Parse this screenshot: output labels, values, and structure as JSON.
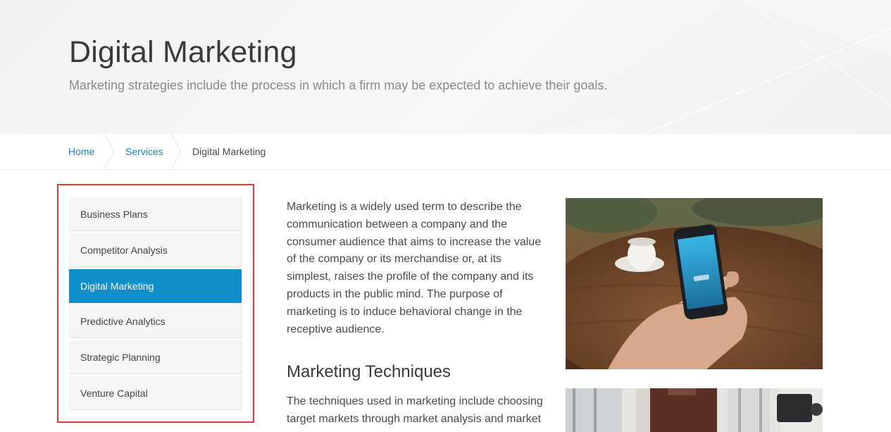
{
  "hero": {
    "title": "Digital Marketing",
    "subtitle": "Marketing strategies include the process in which a firm may be expected to achieve their goals."
  },
  "breadcrumb": {
    "items": [
      "Home",
      "Services",
      "Digital Marketing"
    ]
  },
  "sidebar": {
    "items": [
      {
        "label": "Business Plans",
        "active": false
      },
      {
        "label": "Competitor Analysis",
        "active": false
      },
      {
        "label": "Digital Marketing",
        "active": true
      },
      {
        "label": "Predictive Analytics",
        "active": false
      },
      {
        "label": "Strategic Planning",
        "active": false
      },
      {
        "label": "Venture Capital",
        "active": false
      }
    ]
  },
  "article": {
    "intro": "Marketing is a widely used term to describe the communication between a company and the consumer audience that aims to increase the value of the company or its merchandise or, at its simplest, raises the profile of the company and its products in the public mind. The purpose of marketing is to induce behavioral change in the receptive audience.",
    "heading": "Marketing Techniques",
    "body": "The techniques used in marketing include choosing target markets through market analysis and market"
  },
  "images": {
    "photo1": "hand-holding-smartphone-photo",
    "photo2": "person-in-room-photo"
  },
  "colors": {
    "accent": "#0f8fcc",
    "link": "#1a86c1",
    "highlight_frame": "#e23a3a"
  }
}
